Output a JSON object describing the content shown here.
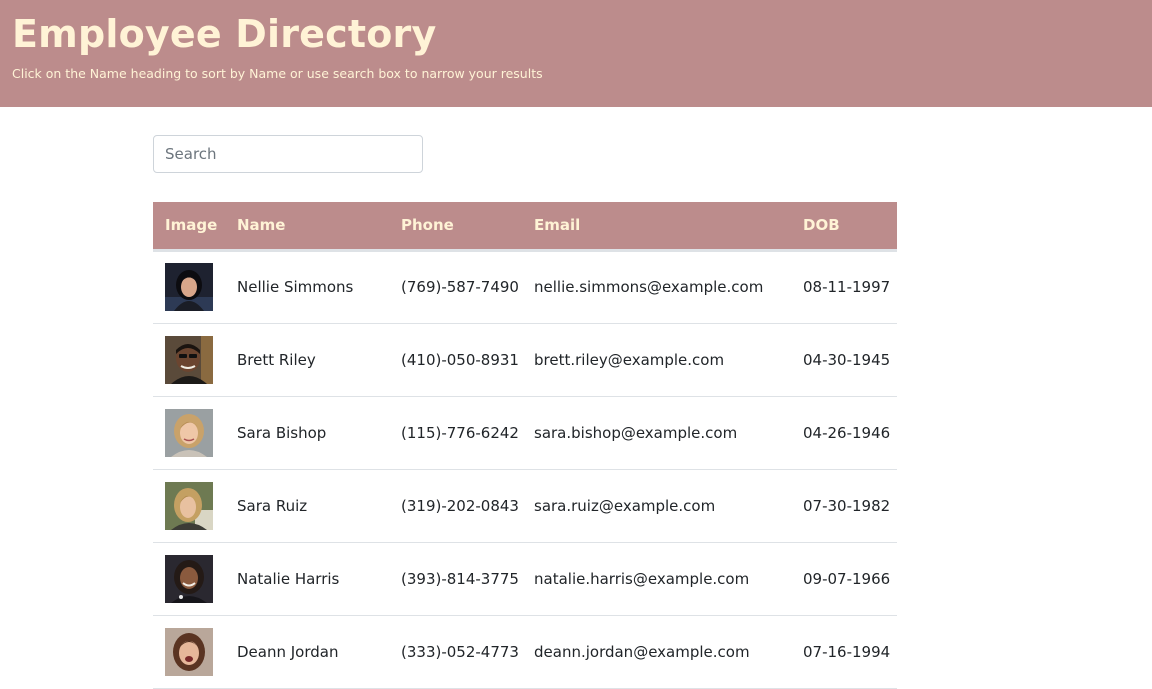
{
  "header": {
    "title": "Employee Directory",
    "subtitle": "Click on the Name heading to sort by Name or use search box to narrow your results",
    "background_color": "#bc8c8c",
    "text_color": "#fff3d6"
  },
  "search": {
    "placeholder": "Search",
    "value": ""
  },
  "table": {
    "columns": {
      "image": "Image",
      "name": "Name",
      "phone": "Phone",
      "email": "Email",
      "dob": "DOB"
    },
    "rows": [
      {
        "name": "Nellie Simmons",
        "phone": "(769)-587-7490",
        "email": "nellie.simmons@example.com",
        "dob": "08-11-1997",
        "avatar": "person-photo-icon"
      },
      {
        "name": "Brett Riley",
        "phone": "(410)-050-8931",
        "email": "brett.riley@example.com",
        "dob": "04-30-1945",
        "avatar": "person-photo-icon"
      },
      {
        "name": "Sara Bishop",
        "phone": "(115)-776-6242",
        "email": "sara.bishop@example.com",
        "dob": "04-26-1946",
        "avatar": "person-photo-icon"
      },
      {
        "name": "Sara Ruiz",
        "phone": "(319)-202-0843",
        "email": "sara.ruiz@example.com",
        "dob": "07-30-1982",
        "avatar": "person-photo-icon"
      },
      {
        "name": "Natalie Harris",
        "phone": "(393)-814-3775",
        "email": "natalie.harris@example.com",
        "dob": "09-07-1966",
        "avatar": "person-photo-icon"
      },
      {
        "name": "Deann Jordan",
        "phone": "(333)-052-4773",
        "email": "deann.jordan@example.com",
        "dob": "07-16-1994",
        "avatar": "person-photo-icon"
      }
    ]
  }
}
